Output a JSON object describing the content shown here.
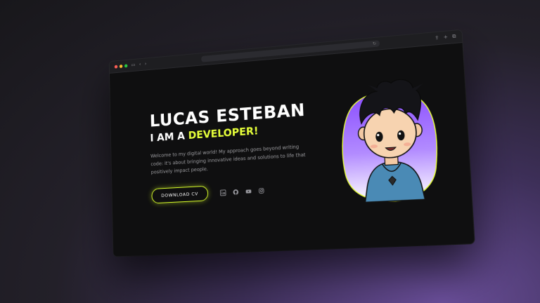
{
  "hero": {
    "name": "LUCAS ESTEBAN",
    "role_prefix": "I AM A ",
    "role_highlight": "DEVELOPER!",
    "description": "Welcome to my digital world! My approach goes beyond writing code: it's about bringing innovative ideas and solutions to life that positively impact people.",
    "cta_label": "DOWNLOAD CV"
  },
  "socials": [
    "linkedin-icon",
    "github-icon",
    "youtube-icon",
    "instagram-icon"
  ],
  "colors": {
    "accent": "#e6ff3a",
    "page_bg": "#0f0f10",
    "blob_top": "#8a4dff",
    "blob_bottom": "#ffffff"
  }
}
